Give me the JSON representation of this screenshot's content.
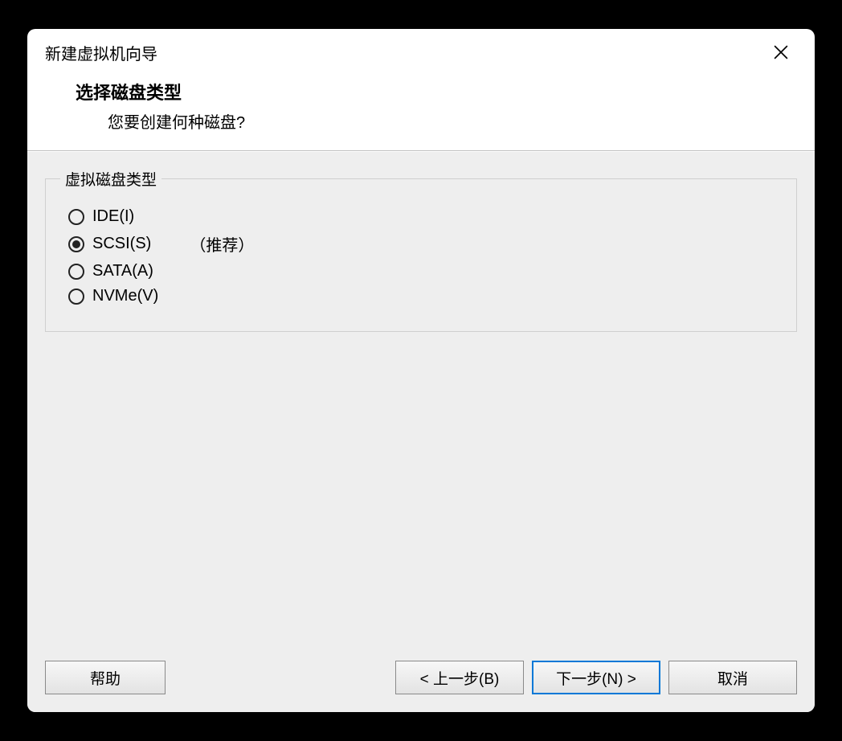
{
  "window": {
    "title": "新建虚拟机向导"
  },
  "header": {
    "title": "选择磁盘类型",
    "subtitle": "您要创建何种磁盘?"
  },
  "group": {
    "legend": "虚拟磁盘类型",
    "options": [
      {
        "label": "IDE(I)",
        "hint": "",
        "selected": false
      },
      {
        "label": "SCSI(S)",
        "hint": "（推荐）",
        "selected": true
      },
      {
        "label": "SATA(A)",
        "hint": "",
        "selected": false
      },
      {
        "label": "NVMe(V)",
        "hint": "",
        "selected": false
      }
    ]
  },
  "footer": {
    "help": "帮助",
    "back": "< 上一步(B)",
    "next": "下一步(N) >",
    "cancel": "取消"
  }
}
